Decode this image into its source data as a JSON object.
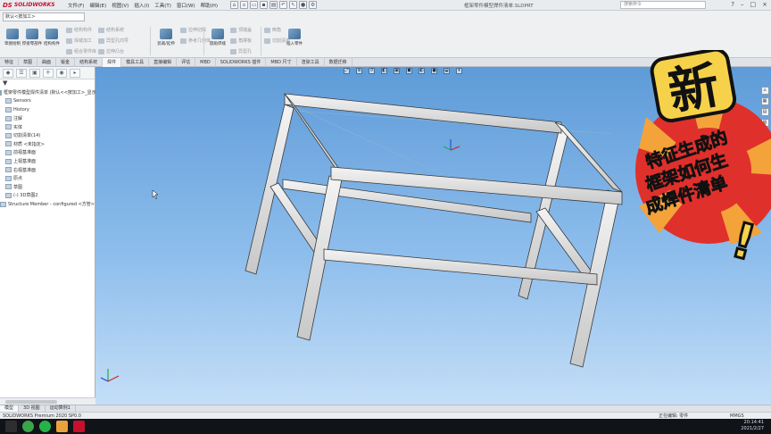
{
  "app": {
    "brand_ds": "DS",
    "brand_name": "SOLIDWORKS",
    "menu": [
      "文件(F)",
      "编辑(E)",
      "视图(V)",
      "插入(I)",
      "工具(T)",
      "窗口(W)",
      "帮助(H)"
    ],
    "document_title": "框架零件模型焊件清单.SLDPRT",
    "search_placeholder": "搜索命令",
    "window_buttons": [
      "?",
      "–",
      "□",
      "×"
    ]
  },
  "ribbon": {
    "config_selector": "默认<按加工>",
    "buttons": [
      "草图绘制",
      "焊接零部件",
      "结构构件",
      "剪裁/延伸",
      "圆角焊缝",
      "顶端盖",
      "角撑板",
      "切割清单",
      "插入零件"
    ],
    "disabled_items": [
      "结构构件",
      "焊缝加工",
      "组合零件库",
      "结构系统",
      "异型孔向导",
      "拉伸凸台",
      "拉伸切除",
      "参考几何体",
      "异型孔",
      "倒角",
      "参考几何体"
    ]
  },
  "command_tabs": [
    "特征",
    "草图",
    "曲面",
    "钣金",
    "结构系统",
    "焊件",
    "模具工具",
    "直接编辑",
    "评估",
    "MBD",
    "SOLIDWORKS 插件",
    "MBD 尺寸",
    "渲染工具",
    "数据迁移"
  ],
  "command_tabs_active": 5,
  "feature_tree": {
    "tabs": [
      "FeatureManager",
      "PropertyManager",
      "ConfigurationManager",
      "DimXpert",
      "Display"
    ],
    "items": [
      "框架零件模型焊件清单 (默认<<按加工>_显示状态 1>)",
      "Sensors",
      "History",
      "注解",
      "实体",
      "切割清单(14)",
      "材质 <未指定>",
      "前视基准面",
      "上视基准面",
      "右视基准面",
      "原点",
      "草图",
      "(-) 3D草图2",
      "Structure Member - configured <方管>"
    ]
  },
  "viewport_tools": [
    "zoom-fit",
    "zoom-area",
    "previous",
    "section",
    "view-orient",
    "display-style",
    "hide-show",
    "appearance",
    "scene",
    "view-settings"
  ],
  "overlay": {
    "big_char": "新",
    "line1": "特征生成的",
    "line2": "框架如何生",
    "line3": "成焊件清单",
    "exclaim": "!"
  },
  "bottom_tabs": [
    "模型",
    "3D 视图",
    "运动算例1"
  ],
  "bottom_tabs_active": 0,
  "status": {
    "left": "SOLIDWORKS Premium 2020 SP0.0",
    "editing": "正在编辑: 零件",
    "units": "MMGS",
    "time": "20:14:41",
    "date": "2021/2/27"
  },
  "colors": {
    "accent_red": "#e0302c",
    "badge_yellow": "#f5d24a",
    "viewport_sky": "#6fa8e0"
  }
}
